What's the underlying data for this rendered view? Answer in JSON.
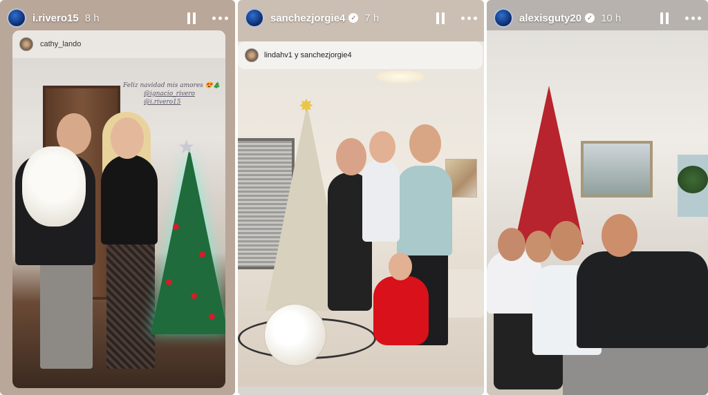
{
  "stories": [
    {
      "username": "i.rivero15",
      "time": "8 h",
      "verified": false,
      "mention": {
        "text": "cathy_lando"
      },
      "caption": [
        "Feliz navidad mis amores 😍🎄",
        "@ignacio_rivero",
        "@i.rivero15"
      ]
    },
    {
      "username": "sanchezjorgie4",
      "time": "7 h",
      "verified": true,
      "mention": {
        "text": "lindahv1 y sanchezjorgie4"
      }
    },
    {
      "username": "alexisguty20",
      "time": "10 h",
      "verified": true
    }
  ],
  "icons": {
    "verified": "✓",
    "pause": "pause-icon",
    "more": "more-options-icon"
  },
  "colors": {
    "header_text": "#ffffff",
    "avatar_primary": "#2f6fd1"
  }
}
